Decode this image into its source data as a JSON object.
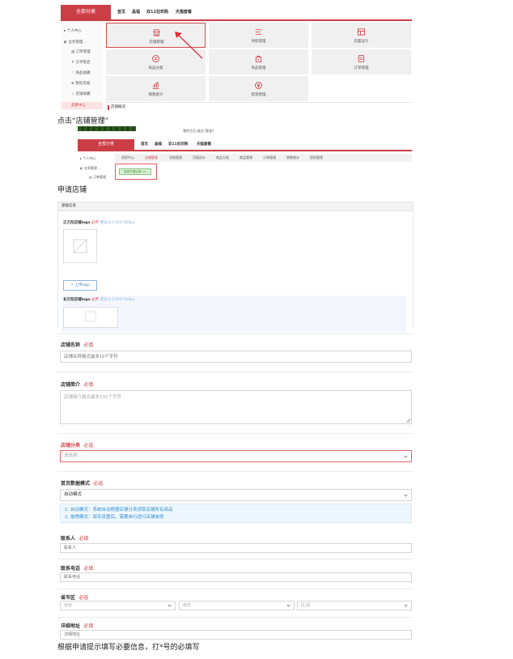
{
  "shot1": {
    "all_categories": "全部分类",
    "nav": [
      "首页",
      "晶福",
      "双11狂欢购",
      "天猫套餐"
    ],
    "sidebar": [
      "个人中心",
      "业务管理",
      "订单管理",
      "订单售后",
      "商品收藏",
      "我的充值",
      "店铺收藏",
      "卖家中心"
    ],
    "tiles": [
      {
        "label": "店铺管理",
        "icon": "store-icon"
      },
      {
        "label": "导航管理",
        "icon": "menu-lines-icon"
      },
      {
        "label": "页面设计",
        "icon": "layout-icon"
      },
      {
        "label": "商品分类",
        "icon": "category-icon"
      },
      {
        "label": "商品管理",
        "icon": "bag-icon"
      },
      {
        "label": "订单管理",
        "icon": "order-icon"
      },
      {
        "label": "销售统计",
        "icon": "chart-icon"
      },
      {
        "label": "提现管理",
        "icon": "yuan-icon"
      }
    ],
    "bottom_label": "店铺概况"
  },
  "caption1": "点击“店铺管理”",
  "shot2": {
    "meta": "我的主页  退出  [登录]",
    "all_categories": "全部分类",
    "nav": [
      "首页",
      "晶福",
      "双11狂欢购",
      "天猫套餐"
    ],
    "tabs": [
      "首家中心",
      "店铺管理",
      "导航管理",
      "页面设计",
      "商品分类",
      "商品管理",
      "订单管理",
      "销售统计",
      "提现管理"
    ],
    "sidebar": [
      "个人中心",
      "业务管理",
      "订单管理"
    ],
    "apply_button": "免费开通店铺 >>"
  },
  "caption2": "申请店铺",
  "shot3": {
    "section": "基础信息",
    "square_logo": {
      "label": "正方形店铺logo",
      "required": "必传",
      "hint": "建议大小300*300px"
    },
    "upload_button": "+ 上传logo",
    "rect_logo": {
      "label": "长方形店铺logo",
      "required": "必传",
      "hint": "建议大小300*100px"
    }
  },
  "form": {
    "shop_name": {
      "label": "店铺名称",
      "required": "必填",
      "placeholder": "店铺名称格式最多16个字符"
    },
    "shop_intro": {
      "label": "店铺简介",
      "required": "必填",
      "placeholder": "店铺简介格式最多230个字符"
    },
    "shop_category": {
      "label": "店铺分类",
      "required": "必选",
      "placeholder": "请选择..."
    },
    "home_mode": {
      "label": "首页数据模式",
      "required": "必选",
      "value": "自动模式",
      "notes": [
        "1. 自动模式：系统自动根据店铺分类读取店铺所有商品",
        "2. 拖拽模式：保存设置后，需要自行进行店铺装修"
      ]
    },
    "contact": {
      "label": "联系人",
      "required": "必填",
      "placeholder": "联系人"
    },
    "phone": {
      "label": "联系电话",
      "required": "必填",
      "placeholder": "联系电话"
    },
    "region": {
      "label": "省市区",
      "required": "必选",
      "province": "省份",
      "city": "城市",
      "district": "区/县"
    },
    "address": {
      "label": "详细地址",
      "required": "必填",
      "placeholder": "详细地址"
    }
  },
  "caption3": "根据申请提示填写必要信息，打*号的必填写",
  "colors": {
    "brand_red": "#cc3e46",
    "info_blue": "#3a8fd0"
  }
}
